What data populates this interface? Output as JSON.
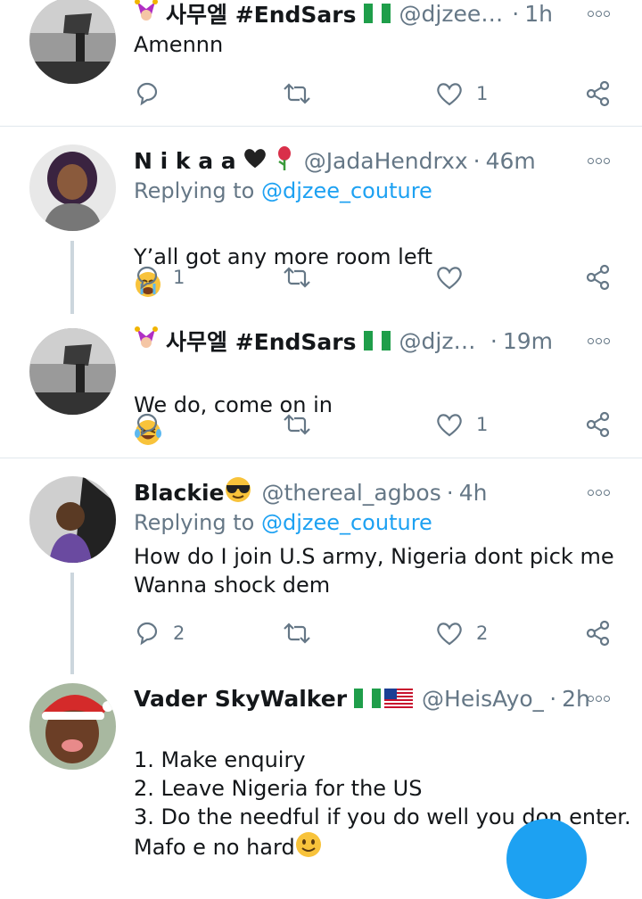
{
  "tweets": [
    {
      "name": "사무엘 #EndSars",
      "handle": "@djzee_c...",
      "time": "1h",
      "body": "Amennn",
      "replies": "",
      "likes": "1"
    },
    {
      "name": "N i k a a",
      "handle": "@JadaHendrxx",
      "time": "46m",
      "replying_label": "Replying to",
      "replying_to": "@djzee_couture",
      "body": "Y’all got any more room left",
      "replies": "1",
      "likes": ""
    },
    {
      "name": "사무엘 #EndSars",
      "handle": "@djzee...",
      "time": "19m",
      "body": "We do, come on in",
      "replies": "",
      "likes": "1"
    },
    {
      "name": "Blackie",
      "handle": "@thereal_agbos",
      "time": "4h",
      "replying_label": "Replying to",
      "replying_to": "@djzee_couture",
      "body": "How do I join  U.S army, Nigeria dont pick me\nWanna shock dem",
      "replies": "2",
      "likes": "2"
    },
    {
      "name": "Vader SkyWalker",
      "handle": "@HeisAyo_",
      "time": "2h",
      "body": "1. Make enquiry\n2. Leave Nigeria for the US\n3. Do the needful if you do well you don enter.\nMafo e no hard"
    }
  ],
  "separator": "·",
  "colors": {
    "accent": "#1da1f2",
    "secondary_text": "#657786",
    "divider": "#e1e8ed",
    "nigeria_green": "#1f9e4a"
  }
}
